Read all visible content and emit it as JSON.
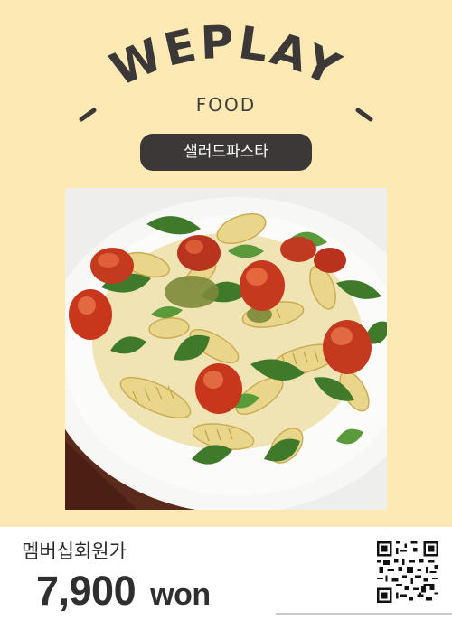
{
  "brand": {
    "title": "WEPLAY",
    "subtitle": "FOOD"
  },
  "menu": {
    "item_name": "샐러드파스타"
  },
  "photo": {
    "subject": "salad-pasta-photo"
  },
  "pricing": {
    "label": "멤버십회원가",
    "amount": "7,900",
    "unit": "won"
  },
  "colors": {
    "background": "#fde9b3",
    "pill": "#3b3837",
    "text": "#3f3c3a",
    "footer": "#ffffff"
  },
  "icons": {
    "qr": "qr-code-icon"
  }
}
